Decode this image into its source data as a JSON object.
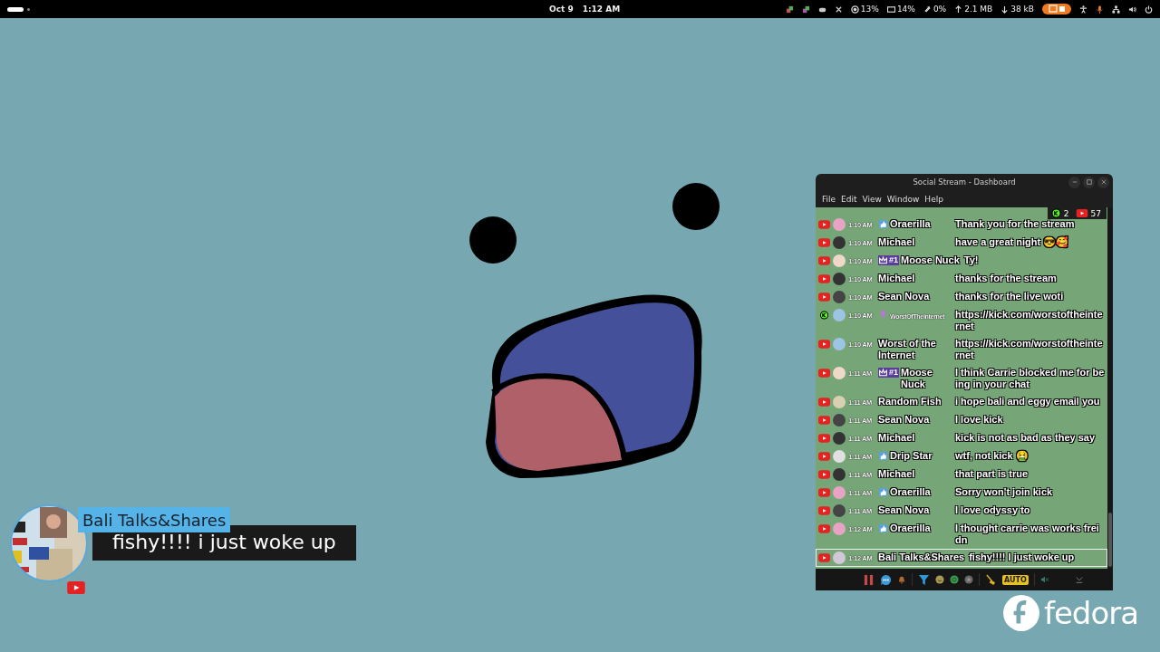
{
  "top_bar": {
    "date": "Oct 9",
    "time": "1:12 AM",
    "indicators": [
      {
        "kind": "cpu",
        "text": "13%"
      },
      {
        "kind": "memory",
        "text": "14%"
      },
      {
        "kind": "swap",
        "text": "0%"
      },
      {
        "kind": "upload",
        "text": "2.1 MB"
      },
      {
        "kind": "download",
        "text": "38 kB"
      }
    ]
  },
  "window": {
    "title": "Social Stream - Dashboard",
    "menu": [
      "File",
      "Edit",
      "View",
      "Window",
      "Help"
    ],
    "counters": [
      {
        "kind": "kick",
        "text": "2"
      },
      {
        "kind": "youtube",
        "text": "57"
      }
    ],
    "messages": [
      {
        "kind": "youtube",
        "color": "#e8a3c4",
        "time": "1:10 AM",
        "badge": {
          "kind": "verified"
        },
        "name": "Oraerilla",
        "message": "Thank you for the stream",
        "highlighted": false
      },
      {
        "kind": "youtube",
        "color": "#333333",
        "time": "1:10 AM",
        "name": "Michael",
        "message": "have a great night 😎🥰",
        "highlighted": false
      },
      {
        "kind": "youtube",
        "color": "#f0d8c8",
        "time": "1:10 AM",
        "badge": {
          "kind": "crown",
          "text": "#1"
        },
        "name": "Moose Nuck",
        "message": "Ty!",
        "inline": true,
        "highlighted": false
      },
      {
        "kind": "youtube",
        "color": "#333333",
        "time": "1:10 AM",
        "name": "Michael",
        "message": "thanks for the stream",
        "highlighted": false
      },
      {
        "kind": "youtube",
        "color": "#444444",
        "time": "1:10 AM",
        "name": "Sean Nova",
        "message": "thanks for the live woti",
        "highlighted": false
      },
      {
        "kind": "kick",
        "color": "#9cc4e4",
        "time": "1:10 AM",
        "badge": {
          "kind": "mic"
        },
        "name": "WorstOfTheInternet",
        "small_name": true,
        "message": "https://kick.com/worstoftheinternet",
        "highlighted": false
      },
      {
        "kind": "youtube",
        "color": "#9cc4e4",
        "time": "1:10 AM",
        "name": "Worst of the Internet",
        "message": "https://kick.com/worstoftheinternet",
        "highlighted": false
      },
      {
        "kind": "youtube",
        "color": "#f0d8c8",
        "time": "1:11 AM",
        "badge": {
          "kind": "crown",
          "text": "#1"
        },
        "name": "Moose Nuck",
        "message": "I think Carrie blocked me for being in your chat",
        "highlighted": false
      },
      {
        "kind": "youtube",
        "color": "#d8d0b0",
        "time": "1:11 AM",
        "name": "Random Fish",
        "message": "i hope bali and eggy email you",
        "highlighted": false
      },
      {
        "kind": "youtube",
        "color": "#444444",
        "time": "1:11 AM",
        "name": "Sean Nova",
        "message": "I love kick",
        "highlighted": false
      },
      {
        "kind": "youtube",
        "color": "#333333",
        "time": "1:11 AM",
        "name": "Michael",
        "message": "kick is not as bad as they say",
        "highlighted": false
      },
      {
        "kind": "youtube",
        "color": "#e0e0e0",
        "time": "1:11 AM",
        "badge": {
          "kind": "verified"
        },
        "name": "Drip Star",
        "message": "wtf, not kick 🤮",
        "highlighted": false
      },
      {
        "kind": "youtube",
        "color": "#333333",
        "time": "1:11 AM",
        "name": "Michael",
        "message": "that part is true",
        "highlighted": false
      },
      {
        "kind": "youtube",
        "color": "#e8a3c4",
        "time": "1:11 AM",
        "badge": {
          "kind": "verified"
        },
        "name": "Oraerilla",
        "message": "Sorry won't join kick",
        "highlighted": false
      },
      {
        "kind": "youtube",
        "color": "#444444",
        "time": "1:11 AM",
        "name": "Sean Nova",
        "message": "I love odyssy to",
        "highlighted": false
      },
      {
        "kind": "youtube",
        "color": "#e8a3c4",
        "time": "1:12 AM",
        "badge": {
          "kind": "verified"
        },
        "name": "Oraerilla",
        "message": "I thought carrie was works freidn",
        "highlighted": false
      },
      {
        "kind": "youtube",
        "color": "#d0c8d8",
        "time": "1:12 AM",
        "name": "Bali Talks&Shares",
        "message": "fishy!!!! I just woke up",
        "inline": true,
        "highlighted": true
      }
    ],
    "toolbar_auto": "AUTO"
  },
  "overlay": {
    "name": "Bali Talks&Shares",
    "message": "fishy!!!! i just woke up"
  },
  "logo": {
    "text": "fedora"
  }
}
